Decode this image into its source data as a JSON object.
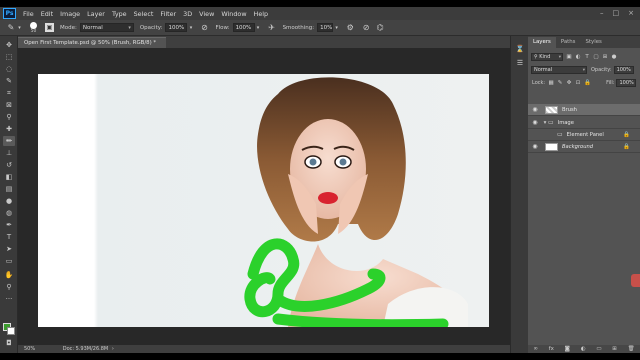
{
  "menu": {
    "logo": "Ps",
    "items": [
      "File",
      "Edit",
      "Image",
      "Layer",
      "Type",
      "Select",
      "Filter",
      "3D",
      "View",
      "Window",
      "Help"
    ]
  },
  "options": {
    "brush_size": "50",
    "mode_label": "Mode:",
    "mode_value": "Normal",
    "opacity_label": "Opacity:",
    "opacity_value": "100%",
    "flow_label": "Flow:",
    "flow_value": "100%",
    "smoothing_label": "Smoothing:",
    "smoothing_value": "10%"
  },
  "document": {
    "tab_title": "Open First Template.psd @ 50% (Brush, RGB/8) *",
    "zoom": "50%",
    "doc_info": "Doc: 5.93M/26.8M"
  },
  "panel": {
    "tabs": [
      "Layers",
      "Paths",
      "Styles"
    ],
    "filter_kind": "Kind",
    "blend_mode": "Normal",
    "opacity_label": "Opacity:",
    "opacity_value": "100%",
    "lock_label": "Lock:",
    "fill_label": "Fill:",
    "fill_value": "100%",
    "layers": [
      {
        "name": "Brush",
        "selected": true
      },
      {
        "name": "Image",
        "selected": false
      },
      {
        "name": "Element Panel",
        "selected": false
      },
      {
        "name": "Background",
        "selected": false
      }
    ]
  },
  "colors": {
    "foreground": "#3c9b2e",
    "background": "#ffffff",
    "brush_stroke": "#2bd12b"
  }
}
